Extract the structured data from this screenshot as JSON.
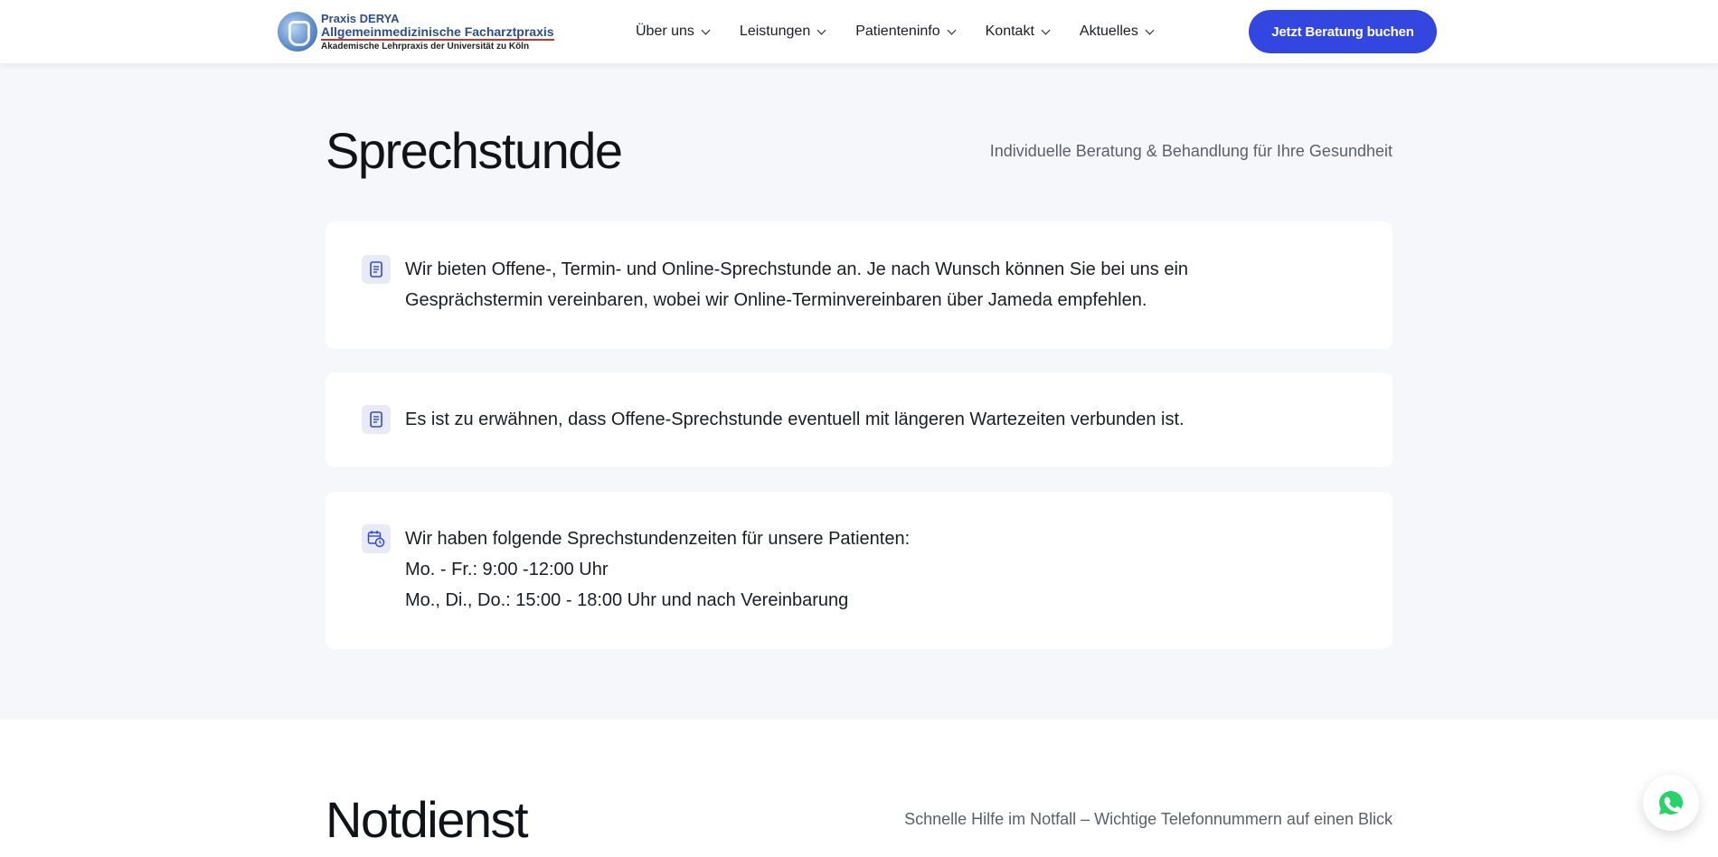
{
  "header": {
    "logo": {
      "line1": "Praxis DERYA",
      "line2": "Allgemeinmedizinische Facharztpraxis",
      "line3": "Akademische Lehrpraxis der Universität zu Köln"
    },
    "nav": [
      {
        "label": "Über uns",
        "icon": "chevron-down-icon"
      },
      {
        "label": "Leistungen",
        "icon": "chevron-down-icon"
      },
      {
        "label": "Patienteninfo",
        "icon": "chevron-down-icon"
      },
      {
        "label": "Kontakt",
        "icon": "chevron-down-icon"
      },
      {
        "label": "Aktuelles",
        "icon": "chevron-down-icon"
      }
    ],
    "cta_label": "Jetzt Beratung buchen"
  },
  "sprechstunde": {
    "title": "Sprechstunde",
    "subtitle": "Individuelle Beratung & Behandlung für Ihre Gesundheit",
    "cards": [
      {
        "icon": "document-icon",
        "lines": [
          "Wir bieten Offene-, Termin- und Online-Sprechstunde an. Je nach Wunsch können Sie bei uns ein Gesprächstermin vereinbaren, wobei wir Online-Terminvereinbaren über Jameda empfehlen."
        ]
      },
      {
        "icon": "document-icon",
        "lines": [
          "Es ist zu erwähnen, dass Offene-Sprechstunde eventuell mit längeren Wartezeiten verbunden ist."
        ]
      },
      {
        "icon": "calendar-clock-icon",
        "lines": [
          "Wir haben folgende Sprechstundenzeiten für unsere Patienten:",
          "Mo. - Fr.: 9:00 -12:00 Uhr",
          "Mo., Di., Do.: 15:00 - 18:00 Uhr und nach Vereinbarung"
        ]
      }
    ]
  },
  "notdienst": {
    "title": "Notdienst",
    "subtitle": "Schnelle Hilfe im Notfall – Wichtige Telefonnummern auf einen Blick"
  },
  "floating": {
    "icon": "whatsapp-icon"
  },
  "colors": {
    "accent": "#3347e0",
    "whatsapp": "#25d366",
    "background": "#f5f7fb"
  }
}
